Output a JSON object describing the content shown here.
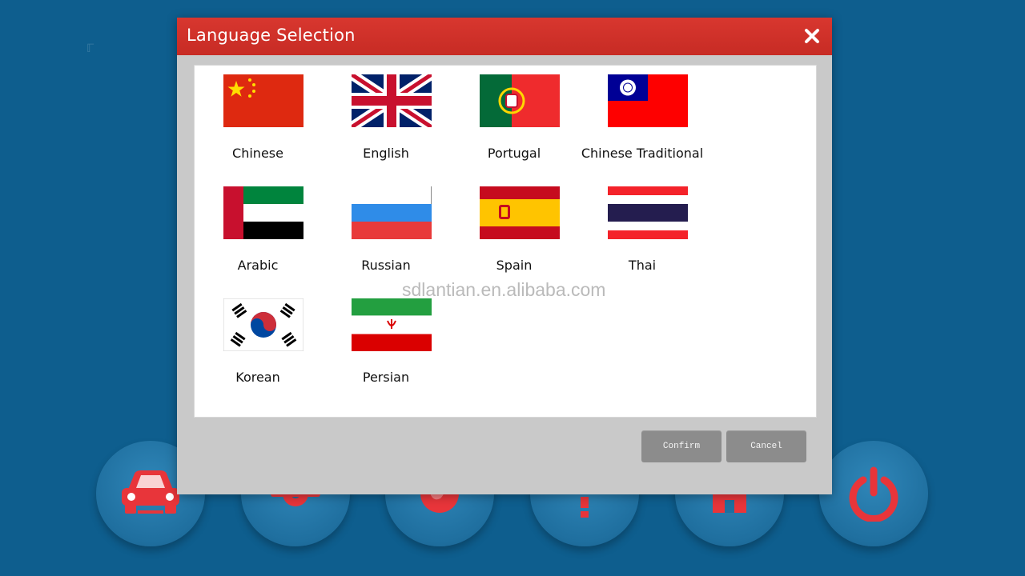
{
  "dialog": {
    "title": "Language Selection",
    "close_icon": "close-icon",
    "confirm_label": "Confirm",
    "cancel_label": "Cancel"
  },
  "languages": [
    {
      "label": "Chinese",
      "flag": "china-flag-icon"
    },
    {
      "label": "English",
      "flag": "uk-flag-icon"
    },
    {
      "label": "Portugal",
      "flag": "portugal-flag-icon"
    },
    {
      "label": "Chinese Traditional",
      "flag": "taiwan-flag-icon"
    },
    {
      "label": "Arabic",
      "flag": "uae-flag-icon"
    },
    {
      "label": "Russian",
      "flag": "russia-flag-icon"
    },
    {
      "label": "Spain",
      "flag": "spain-flag-icon"
    },
    {
      "label": "Thai",
      "flag": "thailand-flag-icon"
    },
    {
      "label": "Korean",
      "flag": "korea-flag-icon"
    },
    {
      "label": "Persian",
      "flag": "iran-flag-icon"
    }
  ],
  "watermark": "sdlantian.en.alibaba.com",
  "launcher": {
    "icons": [
      "car-icon",
      "tools-icon",
      "globe-icon",
      "help-icon",
      "home-icon",
      "power-icon"
    ],
    "accent_color": "#e8353a"
  },
  "colors": {
    "titlebar": "#c72b24",
    "background": "#0e5e8e",
    "button": "#8c8c8c"
  }
}
